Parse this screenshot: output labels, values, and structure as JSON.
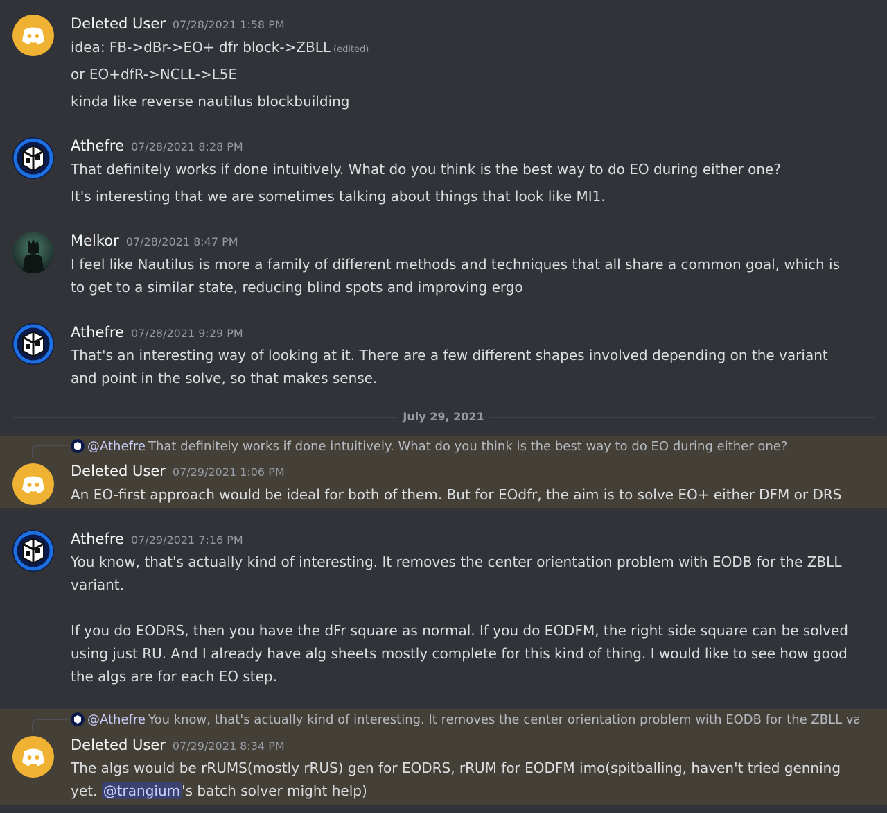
{
  "colors": {
    "background": "#313338",
    "mention_highlight": "#444038",
    "discord_avatar": "#f0b232",
    "mention_pill": "#3c4270"
  },
  "messages": [
    {
      "user": "Deleted User",
      "avatar": "discord-default-avatar",
      "timestamp": "07/28/2021 1:58 PM",
      "lines": [
        "idea: FB->dBr->EO+ dfr block->ZBLL",
        "or EO+dfR->NCLL->L5E",
        "kinda like reverse nautilus blockbuilding"
      ],
      "edited_label": "(edited)"
    },
    {
      "user": "Athefre",
      "avatar": "cube-logo-avatar",
      "timestamp": "07/28/2021 8:28 PM",
      "lines": [
        "That definitely works if done intuitively. What do you think is the best way to do EO during either one?",
        "It's interesting that we are sometimes talking about things that look like MI1."
      ]
    },
    {
      "user": "Melkor",
      "avatar": "dark-figure-avatar",
      "timestamp": "07/28/2021 8:47 PM",
      "lines": [
        "I feel like Nautilus is more a family of different methods and techniques that all share a common goal, which is",
        "to get to a similar state, reducing blind spots and improving ergo"
      ]
    },
    {
      "user": "Athefre",
      "avatar": "cube-logo-avatar",
      "timestamp": "07/28/2021 9:29 PM",
      "lines": [
        "That's an interesting way of looking at it. There are a few different shapes involved depending on the variant",
        "and point in the solve, so that makes sense."
      ]
    },
    {
      "reply_to": {
        "name": "@Athefre",
        "text": "That definitely works if done intuitively. What do you think is the best way to do EO during either one?"
      },
      "user": "Deleted User",
      "avatar": "discord-default-avatar",
      "timestamp": "07/29/2021 1:06 PM",
      "lines": [
        "An EO-first approach would be ideal for both of them. But for EOdfr, the aim is to solve EO+ either DFM or DRS"
      ]
    },
    {
      "user": "Athefre",
      "avatar": "cube-logo-avatar",
      "timestamp": "07/29/2021 7:16 PM",
      "lines": [
        "You know, that's actually kind of interesting. It removes the center orientation problem with EODB for the ZBLL",
        "variant.",
        "If you do EODRS, then you have the dFr square as normal. If you do EODFM, the right side square can be solved",
        "using just RU. And I already have alg sheets mostly complete for this kind of thing. I would like to see how good",
        "the algs are for each EO step."
      ]
    },
    {
      "reply_to": {
        "name": "@Athefre",
        "text": "You know, that's actually kind of interesting. It removes the center orientation problem with EODB for the ZBLL va"
      },
      "user": "Deleted User",
      "avatar": "discord-default-avatar",
      "timestamp": "07/29/2021 8:34 PM",
      "lines": [
        "The algs would be rRUMS(mostly rRUS) gen for EODRS, rRUM for EODFM imo(spitballing, haven't tried genning",
        "yet. "
      ],
      "mention": "@trangium",
      "after_mention": "'s batch solver might help)"
    }
  ],
  "date_divider": "July 29, 2021"
}
